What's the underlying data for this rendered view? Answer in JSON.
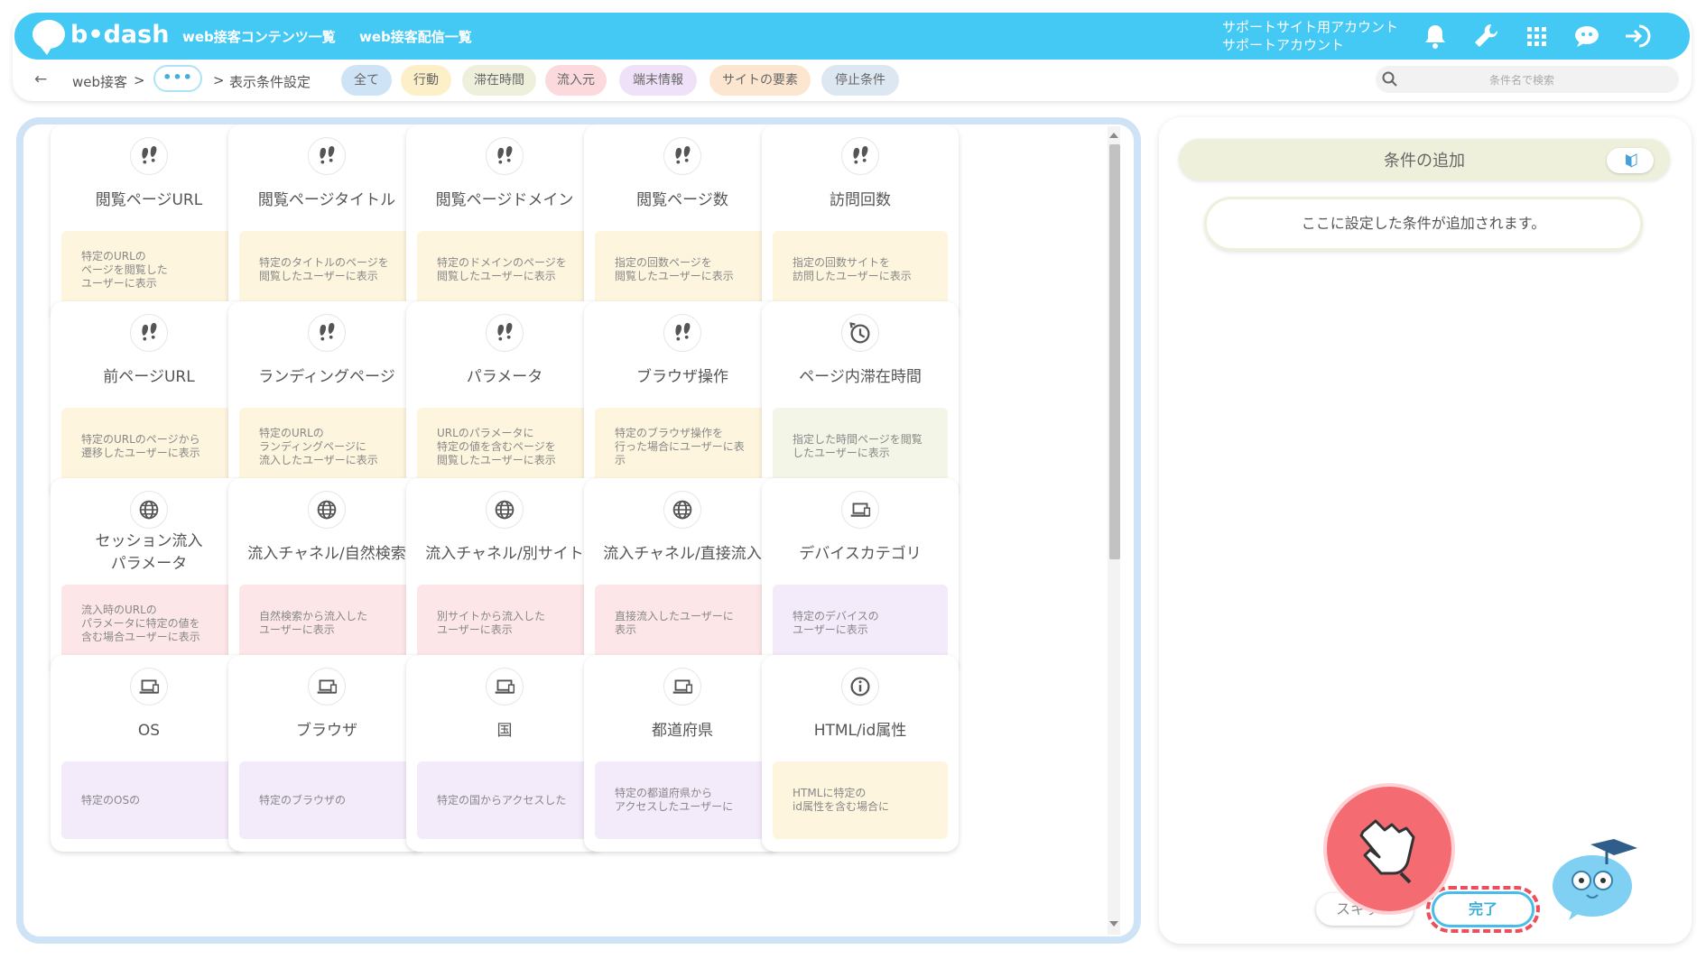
{
  "header": {
    "logo_text": "b•dash",
    "nav": [
      "web接客コンテンツ一覧",
      "web接客配信一覧"
    ],
    "account_line1": "サポートサイト用アカウント",
    "account_line2": "サポートアカウント"
  },
  "breadcrumb": {
    "back": "←",
    "root": "web接客",
    "sep1": ">",
    "ellipsis": "•••",
    "sep2": ">",
    "current": "表示条件設定"
  },
  "tabs": [
    {
      "label": "全て",
      "color": "#cfe3f6"
    },
    {
      "label": "行動",
      "color": "#fdf0c8"
    },
    {
      "label": "滞在時間",
      "color": "#eef0dc"
    },
    {
      "label": "流入元",
      "color": "#fbd9dc"
    },
    {
      "label": "端末情報",
      "color": "#efe1f8"
    },
    {
      "label": "サイトの要素",
      "color": "#fde6cf"
    },
    {
      "label": "停止条件",
      "color": "#dde7f2"
    }
  ],
  "search": {
    "placeholder": "条件名で検索"
  },
  "cards": [
    {
      "title": "閲覧ページURL",
      "desc": "特定のURLの\nページを閲覧した\nユーザーに表示",
      "icon": "footprints-icon",
      "tone": "y"
    },
    {
      "title": "閲覧ページタイトル",
      "desc": "特定のタイトルのページを\n閲覧したユーザーに表示",
      "icon": "footprints-icon",
      "tone": "y"
    },
    {
      "title": "閲覧ページドメイン",
      "desc": "特定のドメインのページを\n閲覧したユーザーに表示",
      "icon": "footprints-icon",
      "tone": "y"
    },
    {
      "title": "閲覧ページ数",
      "desc": "指定の回数ページを\n閲覧したユーザーに表示",
      "icon": "footprints-icon",
      "tone": "y"
    },
    {
      "title": "訪問回数",
      "desc": "指定の回数サイトを\n訪問したユーザーに表示",
      "icon": "footprints-icon",
      "tone": "y"
    },
    {
      "title": "前ページURL",
      "desc": "特定のURLのページから\n遷移したユーザーに表示",
      "icon": "footprints-icon",
      "tone": "y"
    },
    {
      "title": "ランディングページ",
      "desc": "特定のURLの\nランディングページに\n流入したユーザーに表示",
      "icon": "footprints-icon",
      "tone": "y"
    },
    {
      "title": "パラメータ",
      "desc": "URLのパラメータに\n特定の値を含むページを\n閲覧したユーザーに表示",
      "icon": "footprints-icon",
      "tone": "y"
    },
    {
      "title": "ブラウザ操作",
      "desc": "特定のブラウザ操作を\n行った場合にユーザーに表示",
      "icon": "footprints-icon",
      "tone": "y"
    },
    {
      "title": "ページ内滞在時間",
      "desc": "指定した時間ページを閲覧\nしたユーザーに表示",
      "icon": "clock-icon",
      "tone": "g"
    },
    {
      "title": "セッション流入\nパラメータ",
      "desc": "流入時のURLの\nパラメータに特定の値を\n含む場合ユーザーに表示",
      "icon": "globe-icon",
      "tone": "p"
    },
    {
      "title": "流入チャネル/自然検索",
      "desc": "自然検索から流入した\nユーザーに表示",
      "icon": "globe-icon",
      "tone": "p"
    },
    {
      "title": "流入チャネル/別サイト",
      "desc": "別サイトから流入した\nユーザーに表示",
      "icon": "globe-icon",
      "tone": "p"
    },
    {
      "title": "流入チャネル/直接流入",
      "desc": "直接流入したユーザーに\n表示",
      "icon": "globe-icon",
      "tone": "p"
    },
    {
      "title": "デバイスカテゴリ",
      "desc": "特定のデバイスの\nユーザーに表示",
      "icon": "laptop-icon",
      "tone": "v"
    },
    {
      "title": "OS",
      "desc": "特定のOSの",
      "icon": "laptop-icon",
      "tone": "v"
    },
    {
      "title": "ブラウザ",
      "desc": "特定のブラウザの",
      "icon": "laptop-icon",
      "tone": "v"
    },
    {
      "title": "国",
      "desc": "特定の国からアクセスした",
      "icon": "laptop-icon",
      "tone": "v"
    },
    {
      "title": "都道府県",
      "desc": "特定の都道府県から\nアクセスしたユーザーに",
      "icon": "laptop-icon",
      "tone": "v"
    },
    {
      "title": "HTML/id属性",
      "desc": "HTMLに特定の\nid属性を含む場合に",
      "icon": "info-icon",
      "tone": "y"
    }
  ],
  "right": {
    "add_label": "条件の追加",
    "placeholder": "ここに設定した条件が追加されます。",
    "skip_label": "スキップ",
    "done_label": "完了"
  }
}
